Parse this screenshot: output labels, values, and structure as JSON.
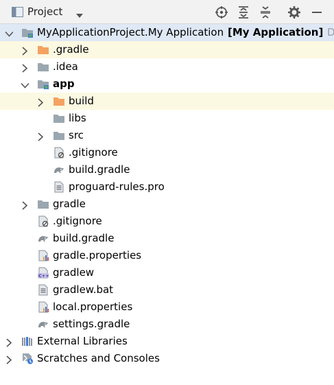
{
  "toolbar": {
    "title": "Project",
    "icons": [
      "view-icon",
      "chevron-down-icon",
      "locate-icon",
      "expand-all-icon",
      "collapse-all-icon",
      "gear-icon",
      "minimize-icon"
    ]
  },
  "tree": [
    {
      "label": "MyApplicationProject.My Application",
      "suffix": "[My Application]",
      "path": "D:",
      "icon": "module-folder-icon",
      "arrow": "down",
      "level": 0
    },
    {
      "label": ".gradle",
      "icon": "excluded-folder-icon",
      "arrow": "right",
      "level": 1
    },
    {
      "label": ".idea",
      "icon": "folder-icon",
      "arrow": "right",
      "level": 1
    },
    {
      "label": "app",
      "icon": "module-folder-icon",
      "arrow": "down",
      "level": 1
    },
    {
      "label": "build",
      "icon": "excluded-folder-icon",
      "arrow": "right",
      "level": 2
    },
    {
      "label": "libs",
      "icon": "folder-icon",
      "arrow": "none",
      "level": 2
    },
    {
      "label": "src",
      "icon": "folder-icon",
      "arrow": "right",
      "level": 2
    },
    {
      "label": ".gitignore",
      "icon": "gitignore-file-icon",
      "arrow": "none",
      "level": 2
    },
    {
      "label": "build.gradle",
      "icon": "gradle-file-icon",
      "arrow": "none",
      "level": 2
    },
    {
      "label": "proguard-rules.pro",
      "icon": "text-file-icon",
      "arrow": "none",
      "level": 2
    },
    {
      "label": "gradle",
      "icon": "folder-icon",
      "arrow": "right",
      "level": 1
    },
    {
      "label": ".gitignore",
      "icon": "gitignore-file-icon",
      "arrow": "none",
      "level": 1
    },
    {
      "label": "build.gradle",
      "icon": "gradle-file-icon",
      "arrow": "none",
      "level": 1
    },
    {
      "label": "gradle.properties",
      "icon": "properties-file-icon",
      "arrow": "none",
      "level": 1
    },
    {
      "label": "gradlew",
      "icon": "cpp-file-icon",
      "arrow": "none",
      "level": 1
    },
    {
      "label": "gradlew.bat",
      "icon": "text-file-icon",
      "arrow": "none",
      "level": 1
    },
    {
      "label": "local.properties",
      "icon": "properties-file-icon",
      "arrow": "none",
      "level": 1
    },
    {
      "label": "settings.gradle",
      "icon": "gradle-file-icon",
      "arrow": "none",
      "level": 1
    },
    {
      "label": "External Libraries",
      "icon": "libraries-icon",
      "arrow": "right",
      "level": 0
    },
    {
      "label": "Scratches and Consoles",
      "icon": "scratches-icon",
      "arrow": "right",
      "level": 0
    }
  ],
  "colors": {
    "selected_row": "#dfe8f5",
    "highlight_row": "#fcf9e2",
    "folder": "#9aa7b0",
    "excluded_folder": "#f4a261",
    "accent_blue": "#3d7bd9"
  }
}
